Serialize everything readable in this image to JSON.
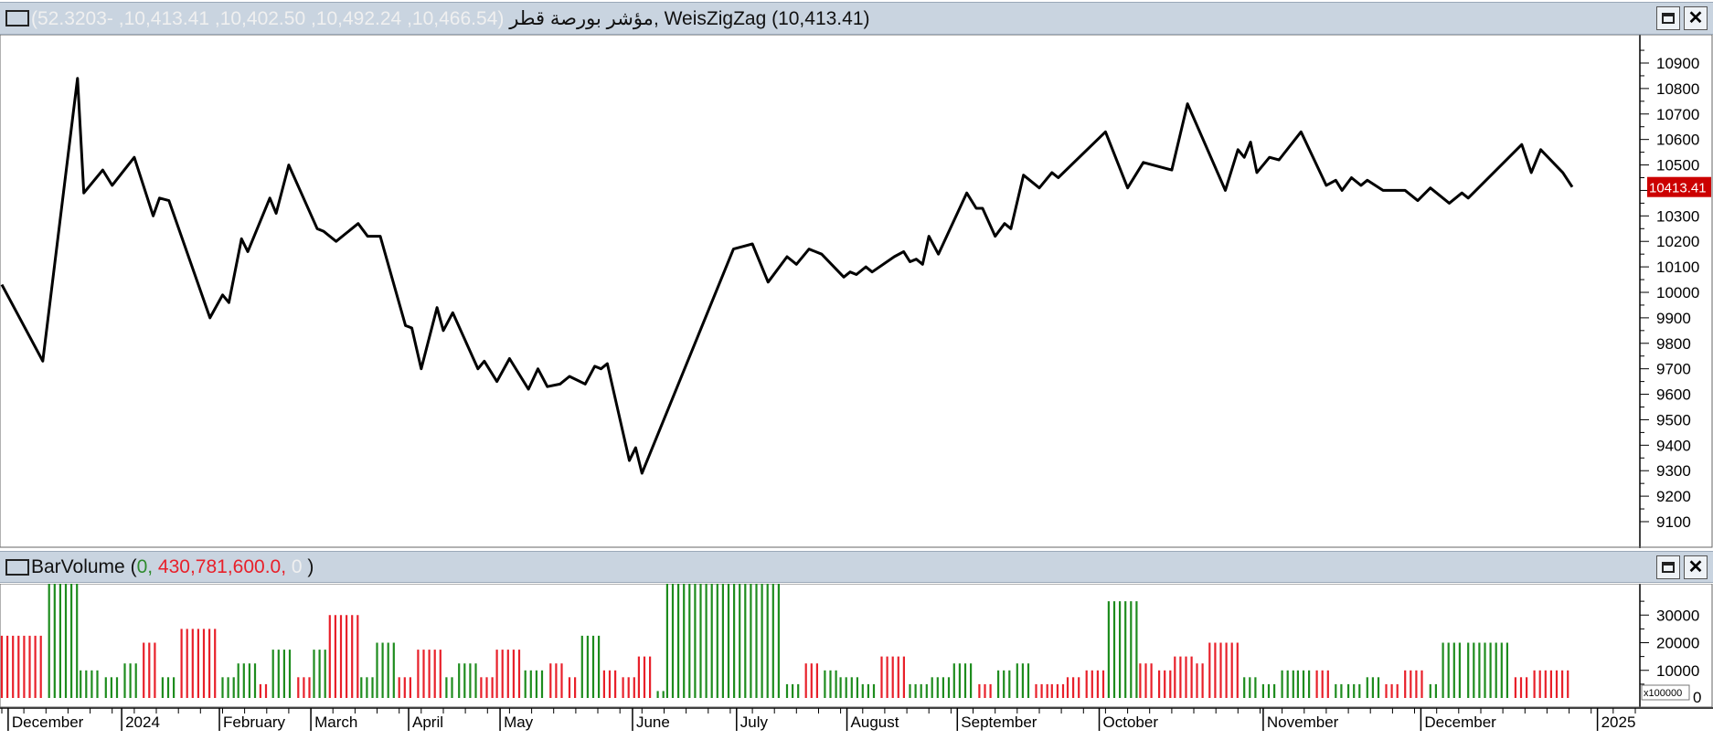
{
  "price_pane": {
    "title_name": "مؤشر بورصة قطر",
    "title_values": "(10,466.54, 10,492.24, 10,402.50, 10,413.41, -52.3203)",
    "indicator": ", WeisZigZag (10,413.41)",
    "last_value_label": "10413.41",
    "maximize_icon": "maximize-icon",
    "close_icon": "close-icon"
  },
  "volume_pane": {
    "title_name": "BarVolume",
    "paren_open": " (",
    "v0": "0",
    "comma1": ", ",
    "v1": "430,781,600.0",
    "comma2": ", ",
    "v2": "0",
    "paren_close": " )",
    "scale_label": "x100000"
  },
  "colors": {
    "up": "#1e8c1e",
    "down": "#e8202a",
    "line": "#000000",
    "last_bg": "#cc0000"
  },
  "chart_data": [
    {
      "type": "line",
      "series": [
        {
          "name": "WeisZigZag",
          "points": [
            [
              "2023-11-23",
              10030
            ],
            [
              "2023-12-06",
              9730
            ],
            [
              "2023-12-17",
              10840
            ],
            [
              "2023-12-19",
              10390
            ],
            [
              "2023-12-25",
              10480
            ],
            [
              "2023-12-28",
              10420
            ],
            [
              "2024-01-04",
              10530
            ],
            [
              "2024-01-10",
              10300
            ],
            [
              "2024-01-12",
              10370
            ],
            [
              "2024-01-15",
              10360
            ],
            [
              "2024-01-28",
              9900
            ],
            [
              "2024-02-01",
              9990
            ],
            [
              "2024-02-03",
              9960
            ],
            [
              "2024-02-07",
              10210
            ],
            [
              "2024-02-09",
              10160
            ],
            [
              "2024-02-16",
              10370
            ],
            [
              "2024-02-18",
              10310
            ],
            [
              "2024-02-22",
              10500
            ],
            [
              "2024-03-02",
              10250
            ],
            [
              "2024-03-04",
              10240
            ],
            [
              "2024-03-08",
              10200
            ],
            [
              "2024-03-15",
              10270
            ],
            [
              "2024-03-18",
              10220
            ],
            [
              "2024-03-22",
              10220
            ],
            [
              "2024-03-30",
              9870
            ],
            [
              "2024-04-01",
              9860
            ],
            [
              "2024-04-04",
              9700
            ],
            [
              "2024-04-09",
              9940
            ],
            [
              "2024-04-11",
              9850
            ],
            [
              "2024-04-14",
              9920
            ],
            [
              "2024-04-22",
              9700
            ],
            [
              "2024-04-24",
              9730
            ],
            [
              "2024-04-28",
              9650
            ],
            [
              "2024-05-02",
              9740
            ],
            [
              "2024-05-08",
              9620
            ],
            [
              "2024-05-11",
              9700
            ],
            [
              "2024-05-14",
              9630
            ],
            [
              "2024-05-18",
              9640
            ],
            [
              "2024-05-21",
              9670
            ],
            [
              "2024-05-26",
              9640
            ],
            [
              "2024-05-29",
              9710
            ],
            [
              "2024-05-31",
              9700
            ],
            [
              "2024-06-02",
              9720
            ],
            [
              "2024-06-09",
              9340
            ],
            [
              "2024-06-11",
              9390
            ],
            [
              "2024-06-13",
              9290
            ],
            [
              "2024-07-12",
              10170
            ],
            [
              "2024-07-15",
              10180
            ],
            [
              "2024-07-18",
              10190
            ],
            [
              "2024-07-23",
              10040
            ],
            [
              "2024-07-29",
              10140
            ],
            [
              "2024-08-01",
              10110
            ],
            [
              "2024-08-05",
              10170
            ],
            [
              "2024-08-09",
              10150
            ],
            [
              "2024-08-16",
              10060
            ],
            [
              "2024-08-18",
              10080
            ],
            [
              "2024-08-20",
              10070
            ],
            [
              "2024-08-23",
              10100
            ],
            [
              "2024-08-25",
              10080
            ],
            [
              "2024-09-01",
              10140
            ],
            [
              "2024-09-04",
              10160
            ],
            [
              "2024-09-06",
              10120
            ],
            [
              "2024-09-08",
              10130
            ],
            [
              "2024-09-10",
              10110
            ],
            [
              "2024-09-12",
              10220
            ],
            [
              "2024-09-15",
              10150
            ],
            [
              "2024-09-24",
              10390
            ],
            [
              "2024-09-27",
              10330
            ],
            [
              "2024-09-29",
              10330
            ],
            [
              "2024-10-03",
              10220
            ],
            [
              "2024-10-06",
              10270
            ],
            [
              "2024-10-08",
              10250
            ],
            [
              "2024-10-12",
              10460
            ],
            [
              "2024-10-17",
              10410
            ],
            [
              "2024-10-21",
              10470
            ],
            [
              "2024-10-23",
              10450
            ],
            [
              "2024-11-07",
              10630
            ],
            [
              "2024-11-14",
              10410
            ],
            [
              "2024-11-19",
              10510
            ],
            [
              "2024-11-28",
              10480
            ],
            [
              "2024-12-03",
              10740
            ],
            [
              "2024-12-15",
              10400
            ],
            [
              "2024-12-19",
              10560
            ],
            [
              "2024-12-21",
              10530
            ],
            [
              "2024-12-23",
              10590
            ],
            [
              "2024-12-25",
              10470
            ],
            [
              "2024-12-29",
              10530
            ],
            [
              "2025-01-01",
              10520
            ],
            [
              "2025-01-08",
              10630
            ],
            [
              "2025-01-16",
              10420
            ],
            [
              "2025-01-19",
              10440
            ],
            [
              "2025-01-21",
              10400
            ],
            [
              "2025-01-24",
              10450
            ],
            [
              "2025-01-27",
              10420
            ],
            [
              "2025-01-29",
              10440
            ],
            [
              "2025-02-03",
              10400
            ],
            [
              "2025-02-10",
              10400
            ],
            [
              "2025-02-14",
              10360
            ],
            [
              "2025-02-18",
              10410
            ],
            [
              "2025-02-24",
              10350
            ],
            [
              "2025-02-28",
              10390
            ],
            [
              "2025-03-02",
              10370
            ],
            [
              "2025-03-19",
              10580
            ],
            [
              "2025-03-22",
              10470
            ],
            [
              "2025-03-25",
              10560
            ],
            [
              "2025-04-01",
              10470
            ],
            [
              "2025-04-04",
              10413.41
            ]
          ]
        }
      ],
      "ylim": [
        9000,
        11000
      ],
      "yticks": [
        9100,
        9200,
        9300,
        9400,
        9500,
        9600,
        9700,
        9800,
        9900,
        10000,
        10100,
        10200,
        10300,
        10400,
        10500,
        10600,
        10700,
        10800,
        10900
      ],
      "ytick_labels": [
        "9100",
        "9200",
        "9300",
        "9400",
        "9500",
        "9600",
        "9700",
        "9800",
        "9900",
        "10000",
        "10100",
        "10200",
        "10300",
        "10400",
        "10500",
        "10600",
        "10700",
        "10800",
        "10900"
      ],
      "last_value": 10413.41,
      "grid": false
    },
    {
      "type": "bar",
      "series": [
        {
          "name": "BarVolume",
          "segments": [
            [
              "2023-11-23",
              "2023-12-07",
              9,
              "down"
            ],
            [
              "2023-12-08",
              "2023-12-17",
              22,
              "up"
            ],
            [
              "2023-12-18",
              "2023-12-25",
              4,
              "up"
            ],
            [
              "2023-12-26",
              "2023-12-31",
              3,
              "up"
            ],
            [
              "2024-01-01",
              "2024-01-06",
              5,
              "up"
            ],
            [
              "2024-01-07",
              "2024-01-12",
              8,
              "down"
            ],
            [
              "2024-01-13",
              "2024-01-18",
              3,
              "up"
            ],
            [
              "2024-01-19",
              "2024-01-31",
              10,
              "down"
            ],
            [
              "2024-02-01",
              "2024-02-05",
              3,
              "up"
            ],
            [
              "2024-02-06",
              "2024-02-12",
              5,
              "up"
            ],
            [
              "2024-02-13",
              "2024-02-16",
              2,
              "down"
            ],
            [
              "2024-02-17",
              "2024-02-24",
              7,
              "up"
            ],
            [
              "2024-02-25",
              "2024-02-29",
              3,
              "down"
            ],
            [
              "2024-03-01",
              "2024-03-05",
              7,
              "up"
            ],
            [
              "2024-03-06",
              "2024-03-15",
              12,
              "down"
            ],
            [
              "2024-03-16",
              "2024-03-20",
              3,
              "up"
            ],
            [
              "2024-03-21",
              "2024-03-27",
              8,
              "up"
            ],
            [
              "2024-03-28",
              "2024-04-02",
              3,
              "down"
            ],
            [
              "2024-04-03",
              "2024-04-11",
              7,
              "down"
            ],
            [
              "2024-04-12",
              "2024-04-15",
              3,
              "up"
            ],
            [
              "2024-04-16",
              "2024-04-22",
              5,
              "up"
            ],
            [
              "2024-04-23",
              "2024-04-27",
              3,
              "down"
            ],
            [
              "2024-04-28",
              "2024-05-06",
              7,
              "down"
            ],
            [
              "2024-05-07",
              "2024-05-14",
              4,
              "up"
            ],
            [
              "2024-05-15",
              "2024-05-20",
              5,
              "down"
            ],
            [
              "2024-05-21",
              "2024-05-24",
              3,
              "down"
            ],
            [
              "2024-05-25",
              "2024-05-31",
              9,
              "up"
            ],
            [
              "2024-06-01",
              "2024-06-06",
              4,
              "down"
            ],
            [
              "2024-06-07",
              "2024-06-11",
              3,
              "down"
            ],
            [
              "2024-06-12",
              "2024-06-17",
              6,
              "down"
            ],
            [
              "2024-06-18",
              "2024-06-20",
              1,
              "up"
            ],
            [
              "2024-06-21",
              "2024-07-28",
              38,
              "up"
            ],
            [
              "2024-07-29",
              "2024-08-03",
              2,
              "up"
            ],
            [
              "2024-08-04",
              "2024-08-09",
              5,
              "down"
            ],
            [
              "2024-08-10",
              "2024-08-14",
              4,
              "up"
            ],
            [
              "2024-08-15",
              "2024-08-21",
              3,
              "up"
            ],
            [
              "2024-08-22",
              "2024-08-27",
              2,
              "up"
            ],
            [
              "2024-08-28",
              "2024-09-05",
              6,
              "down"
            ],
            [
              "2024-09-06",
              "2024-09-12",
              2,
              "up"
            ],
            [
              "2024-09-13",
              "2024-09-19",
              3,
              "up"
            ],
            [
              "2024-09-20",
              "2024-09-27",
              5,
              "up"
            ],
            [
              "2024-09-28",
              "2024-10-03",
              2,
              "down"
            ],
            [
              "2024-10-04",
              "2024-10-09",
              4,
              "up"
            ],
            [
              "2024-10-10",
              "2024-10-15",
              5,
              "up"
            ],
            [
              "2024-10-16",
              "2024-10-20",
              2,
              "down"
            ],
            [
              "2024-10-21",
              "2024-10-25",
              2,
              "down"
            ],
            [
              "2024-10-26",
              "2024-10-31",
              3,
              "down"
            ],
            [
              "2024-11-01",
              "2024-11-07",
              4,
              "down"
            ],
            [
              "2024-11-08",
              "2024-11-17",
              14,
              "up"
            ],
            [
              "2024-11-18",
              "2024-11-23",
              5,
              "down"
            ],
            [
              "2024-11-24",
              "2024-11-28",
              4,
              "down"
            ],
            [
              "2024-11-29",
              "2024-12-05",
              6,
              "down"
            ],
            [
              "2024-12-06",
              "2024-12-09",
              5,
              "down"
            ],
            [
              "2024-12-10",
              "2024-12-20",
              8,
              "down"
            ],
            [
              "2024-12-21",
              "2024-12-26",
              3,
              "up"
            ],
            [
              "2024-12-27",
              "2025-01-01",
              2,
              "up"
            ],
            [
              "2025-01-02",
              "2025-01-06",
              4,
              "up"
            ],
            [
              "2025-01-07",
              "2025-01-12",
              4,
              "up"
            ],
            [
              "2025-01-13",
              "2025-01-18",
              4,
              "down"
            ],
            [
              "2025-01-19",
              "2025-01-22",
              2,
              "up"
            ],
            [
              "2025-01-23",
              "2025-01-28",
              2,
              "up"
            ],
            [
              "2025-01-29",
              "2025-02-03",
              3,
              "up"
            ],
            [
              "2025-02-04",
              "2025-02-09",
              2,
              "down"
            ],
            [
              "2025-02-10",
              "2025-02-17",
              4,
              "down"
            ],
            [
              "2025-02-18",
              "2025-02-21",
              2,
              "up"
            ],
            [
              "2025-02-22",
              "2025-03-01",
              8,
              "up"
            ],
            [
              "2025-03-02",
              "2025-03-16",
              8,
              "up"
            ],
            [
              "2025-03-17",
              "2025-03-22",
              3,
              "down"
            ],
            [
              "2025-03-23",
              "2025-04-04",
              4,
              "down"
            ]
          ]
        }
      ],
      "ylim": [
        0,
        40000
      ],
      "yticks": [
        10000,
        20000,
        30000
      ],
      "ytick_labels": [
        "10000",
        "20000",
        "30000"
      ],
      "zero_label": "0",
      "value_scale": 2500
    }
  ],
  "x_axis": {
    "labels": [
      {
        "text": "December",
        "date": "2023-11-25"
      },
      {
        "text": "2024",
        "date": "2023-12-31"
      },
      {
        "text": "February",
        "date": "2024-01-31"
      },
      {
        "text": "March",
        "date": "2024-02-29"
      },
      {
        "text": "April",
        "date": "2024-03-31"
      },
      {
        "text": "May",
        "date": "2024-04-29"
      },
      {
        "text": "June",
        "date": "2024-06-10"
      },
      {
        "text": "July",
        "date": "2024-07-13"
      },
      {
        "text": "August",
        "date": "2024-08-17"
      },
      {
        "text": "September",
        "date": "2024-09-21"
      },
      {
        "text": "October",
        "date": "2024-11-05"
      },
      {
        "text": "November",
        "date": "2024-12-27"
      },
      {
        "text": "December",
        "date": "2025-02-15"
      },
      {
        "text": "2025",
        "date": "2025-04-12"
      }
    ],
    "range": [
      "2023-11-23",
      "2025-04-04"
    ]
  }
}
